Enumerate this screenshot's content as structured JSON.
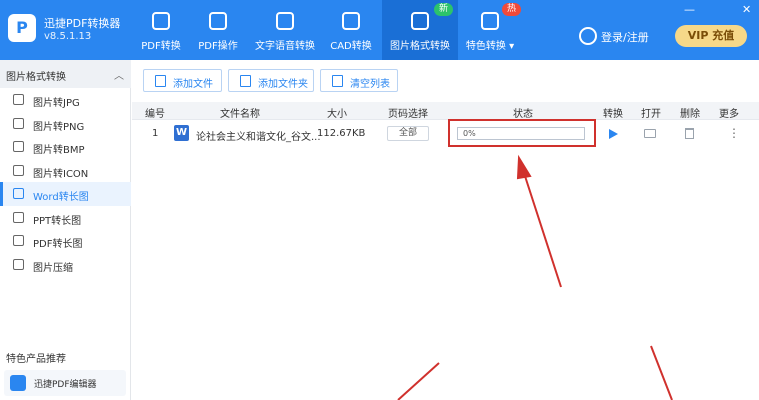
{
  "app": {
    "name": "迅捷PDF转换器",
    "version": "v8.5.1.13"
  },
  "nav": [
    {
      "label": "PDF转换",
      "icon": "pdf-convert-icon"
    },
    {
      "label": "PDF操作",
      "icon": "pdf-operate-icon"
    },
    {
      "label": "文字语音转换",
      "icon": "text-to-speech-icon"
    },
    {
      "label": "CAD转换",
      "icon": "cad-icon"
    },
    {
      "label": "图片格式转换",
      "icon": "image-convert-icon",
      "badge": "新",
      "active": true
    },
    {
      "label": "特色转换",
      "icon": "special-convert-icon",
      "badge": "热",
      "dropdown": "▾"
    }
  ],
  "user": {
    "login_label": "登录/注册",
    "vip_label": "VIP 充值"
  },
  "window": {
    "minimize": "—",
    "close": "✕"
  },
  "sidebar": {
    "section_title": "图片格式转换",
    "collapse_glyph": "︿",
    "items": [
      {
        "label": "图片转JPG"
      },
      {
        "label": "图片转PNG"
      },
      {
        "label": "图片转BMP"
      },
      {
        "label": "图片转ICON"
      },
      {
        "label": "Word转长图",
        "active": true
      },
      {
        "label": "PPT转长图"
      },
      {
        "label": "PDF转长图"
      },
      {
        "label": "图片压缩"
      }
    ],
    "featured_title": "特色产品推荐",
    "featured_item": "迅捷PDF编辑器"
  },
  "toolbar": {
    "add_file": "添加文件",
    "add_folder": "添加文件夹",
    "clear_list": "清空列表"
  },
  "table": {
    "headers": {
      "index": "编号",
      "name": "文件名称",
      "size": "大小",
      "pages": "页码选择",
      "status": "状态",
      "convert": "转换",
      "open": "打开",
      "delete": "删除",
      "more": "更多"
    },
    "rows": [
      {
        "index": "1",
        "file_type": "W",
        "name": "论社会主义和谐文化_谷文...",
        "size": "112.67KB",
        "pages": "全部",
        "progress_label": "0%",
        "progress": 0
      }
    ]
  },
  "colors": {
    "brand": "#2a86f0",
    "brand_dark": "#1a6fd6",
    "highlight": "#d0312d",
    "vip_bg": "#f6d889"
  }
}
